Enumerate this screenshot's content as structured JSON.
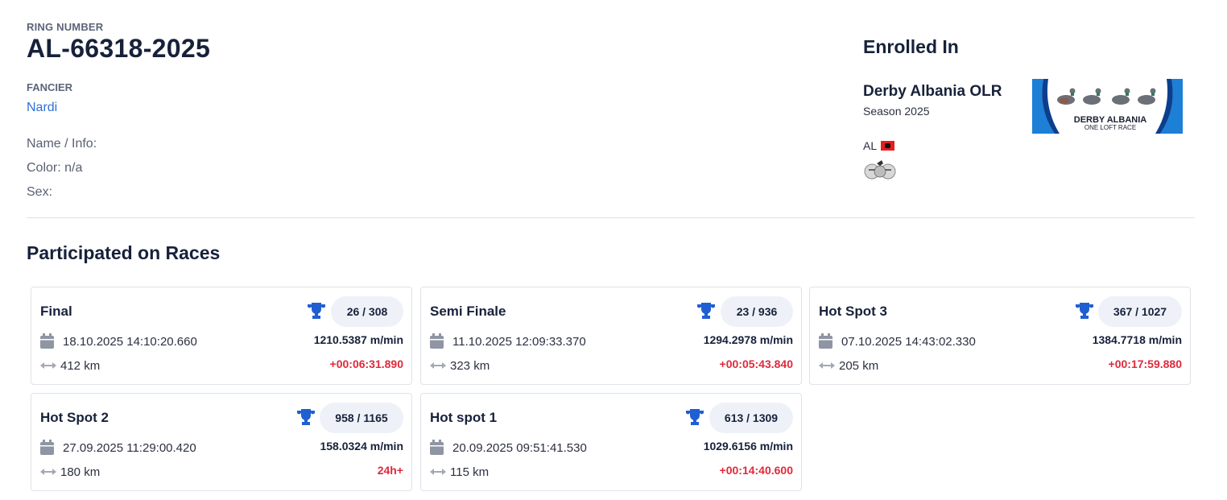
{
  "bird": {
    "ring_label": "RING NUMBER",
    "ring_number": "AL-66318-2025",
    "fancier_label": "FANCIER",
    "fancier_name": "Nardi",
    "name_info": "Name / Info:",
    "color": "Color: n/a",
    "sex": "Sex:"
  },
  "enrolled": {
    "title": "Enrolled In",
    "org_name": "Derby Albania OLR",
    "season": "Season 2025",
    "country_code": "AL",
    "logo_text_1": "DERBY ALBANIA",
    "logo_text_2": "ONE LOFT RACE"
  },
  "races_section": {
    "title": "Participated on Races"
  },
  "races": [
    {
      "name": "Final",
      "rank": "26 / 308",
      "date": "18.10.2025 14:10:20.660",
      "distance": "412 km",
      "speed": "1210.5387 m/min",
      "diff": "+00:06:31.890"
    },
    {
      "name": "Semi Finale",
      "rank": "23 / 936",
      "date": "11.10.2025 12:09:33.370",
      "distance": "323 km",
      "speed": "1294.2978 m/min",
      "diff": "+00:05:43.840"
    },
    {
      "name": "Hot Spot 3",
      "rank": "367 / 1027",
      "date": "07.10.2025 14:43:02.330",
      "distance": "205 km",
      "speed": "1384.7718 m/min",
      "diff": "+00:17:59.880"
    },
    {
      "name": "Hot Spot 2",
      "rank": "958 / 1165",
      "date": "27.09.2025 11:29:00.420",
      "distance": "180 km",
      "speed": "158.0324 m/min",
      "diff": "24h+"
    },
    {
      "name": "Hot spot 1",
      "rank": "613 / 1309",
      "date": "20.09.2025 09:51:41.530",
      "distance": "115 km",
      "speed": "1029.6156 m/min",
      "diff": "+00:14:40.600"
    }
  ],
  "colors": {
    "accent_blue": "#2f6fd6",
    "trophy_blue": "#1f5fd1",
    "diff_red": "#e0293b",
    "pill_bg": "#eef2f8"
  },
  "icons": {
    "trophy": "trophy-icon",
    "calendar": "calendar-icon",
    "distance": "distance-arrow-icon",
    "flag": "albania-flag-icon"
  }
}
